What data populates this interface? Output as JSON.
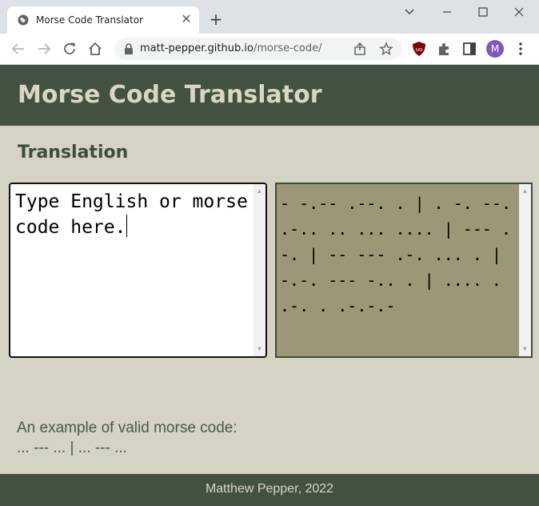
{
  "browser": {
    "tab_title": "Morse Code Translator",
    "tab_close": "✕",
    "new_tab": "+",
    "url_host": "matt-pepper.github.io",
    "url_path": "/morse-code/",
    "profile_initial": "M",
    "icons": [
      "globe-icon",
      "minimize-icon",
      "maximize-icon",
      "close-icon",
      "back-arrow-icon",
      "forward-arrow-icon",
      "reload-icon",
      "home-icon",
      "lock-icon",
      "share-icon",
      "star-icon",
      "ublock-icon",
      "puzzle-icon",
      "side-panel-icon",
      "kebab-menu-icon"
    ]
  },
  "page": {
    "title": "Morse Code Translator",
    "section_heading": "Translation",
    "input_text": "Type English or morse code here.",
    "output_text": "- -.-- .--. . | . -. --. .-.. .. ... .... | --- .-. | -- --- .-. ... . | -.-. --- -.. . | .... . .-. . .-.-.-",
    "example_label": "An example of valid morse code:",
    "example_code": "... --- ... | ... --- ...",
    "footer": "Matthew Pepper, 2022"
  },
  "colors": {
    "header_bg": "#435240",
    "page_bg": "#d4d3c4",
    "output_bg": "#9c9776",
    "title_text": "#d8d6c4",
    "heading_text": "#3e4d3a"
  }
}
